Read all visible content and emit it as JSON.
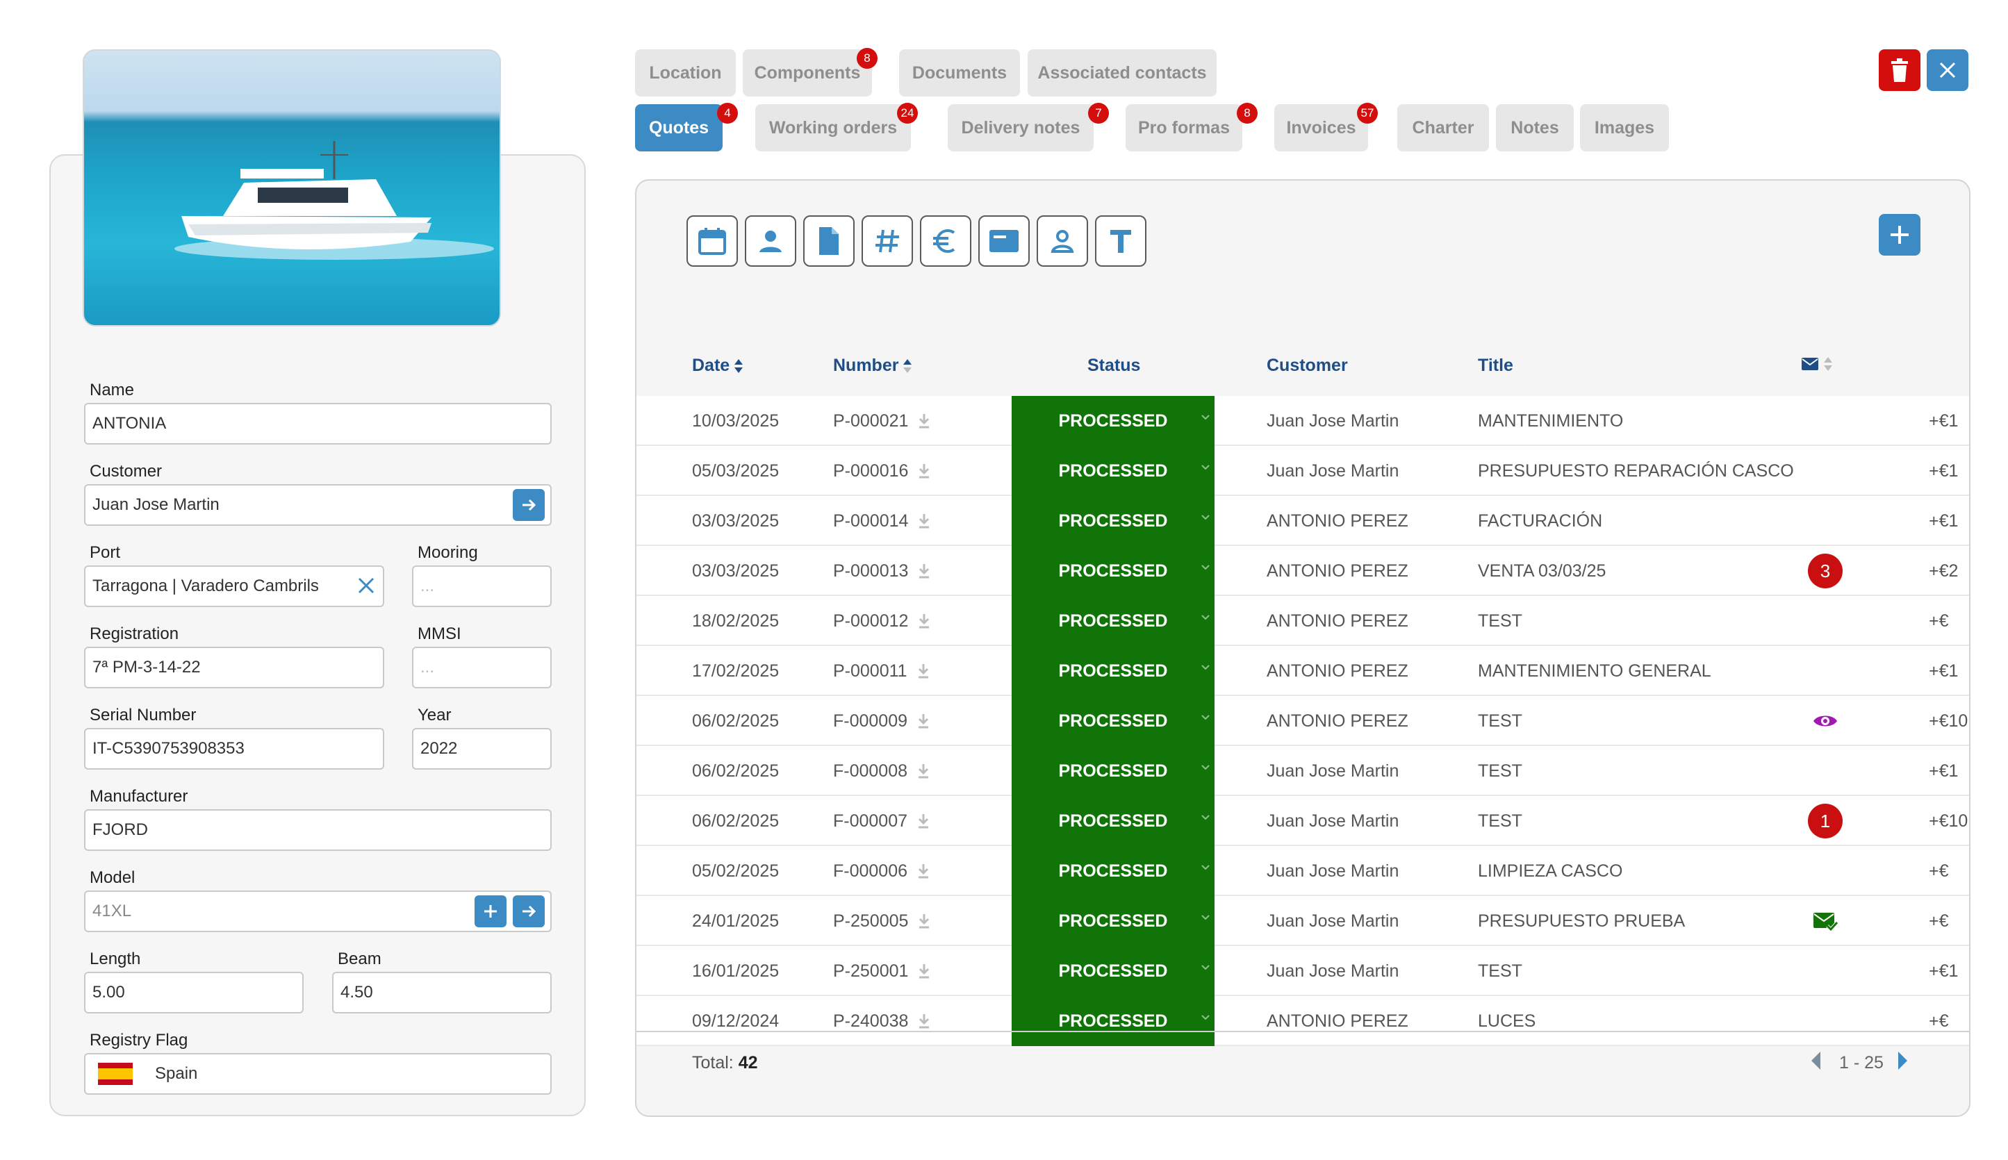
{
  "boat": {
    "fields": {
      "name": {
        "label": "Name",
        "value": "ANTONIA"
      },
      "customer": {
        "label": "Customer",
        "value": "Juan Jose Martin"
      },
      "port": {
        "label": "Port",
        "value": "Tarragona | Varadero Cambrils"
      },
      "mooring": {
        "label": "Mooring",
        "placeholder": "..."
      },
      "registration": {
        "label": "Registration",
        "value": "7ª PM-3-14-22"
      },
      "mmsi": {
        "label": "MMSI",
        "placeholder": "..."
      },
      "serial": {
        "label": "Serial Number",
        "value": "IT-C5390753908353"
      },
      "year": {
        "label": "Year",
        "value": "2022"
      },
      "manufacturer": {
        "label": "Manufacturer",
        "value": "FJORD"
      },
      "model": {
        "label": "Model",
        "value": "41XL"
      },
      "length": {
        "label": "Length",
        "value": "5.00"
      },
      "beam": {
        "label": "Beam",
        "value": "4.50"
      },
      "flag": {
        "label": "Registry Flag",
        "value": "Spain"
      }
    }
  },
  "tabs_row1": [
    {
      "label": "Location",
      "badge": ""
    },
    {
      "label": "Components",
      "badge": "8"
    },
    {
      "label": "Documents",
      "badge": ""
    },
    {
      "label": "Associated contacts",
      "badge": ""
    }
  ],
  "tabs_row2": [
    {
      "label": "Quotes",
      "badge": "4",
      "active": true
    },
    {
      "label": "Working orders",
      "badge": "24"
    },
    {
      "label": "Delivery notes",
      "badge": "7"
    },
    {
      "label": "Pro formas",
      "badge": "8"
    },
    {
      "label": "Invoices",
      "badge": "57"
    },
    {
      "label": "Charter",
      "badge": ""
    },
    {
      "label": "Notes",
      "badge": ""
    },
    {
      "label": "Images",
      "badge": ""
    }
  ],
  "toolbar_icons": [
    "calendar-icon",
    "user-icon",
    "document-icon",
    "hash-icon",
    "euro-icon",
    "card-icon",
    "contact-icon",
    "text-icon"
  ],
  "table": {
    "headers": {
      "date": "Date",
      "number": "Number",
      "status": "Status",
      "customer": "Customer",
      "title": "Title"
    },
    "rows": [
      {
        "date": "10/03/2025",
        "number": "P-000021",
        "status": "PROCESSED",
        "customer": "Juan Jose Martin",
        "title": "MANTENIMIENTO",
        "extra": "",
        "amount": "+€1"
      },
      {
        "date": "05/03/2025",
        "number": "P-000016",
        "status": "PROCESSED",
        "customer": "Juan Jose Martin",
        "title": "PRESUPUESTO REPARACIÓN CASCO",
        "extra": "",
        "amount": "+€1"
      },
      {
        "date": "03/03/2025",
        "number": "P-000014",
        "status": "PROCESSED",
        "customer": "ANTONIO PEREZ",
        "title": "FACTURACIÓN",
        "extra": "",
        "amount": "+€1"
      },
      {
        "date": "03/03/2025",
        "number": "P-000013",
        "status": "PROCESSED",
        "customer": "ANTONIO PEREZ",
        "title": "VENTA 03/03/25",
        "extra": "badge:3",
        "amount": "+€2"
      },
      {
        "date": "18/02/2025",
        "number": "P-000012",
        "status": "PROCESSED",
        "customer": "ANTONIO PEREZ",
        "title": "TEST",
        "extra": "",
        "amount": "+€"
      },
      {
        "date": "17/02/2025",
        "number": "P-000011",
        "status": "PROCESSED",
        "customer": "ANTONIO PEREZ",
        "title": "MANTENIMIENTO GENERAL",
        "extra": "",
        "amount": "+€1"
      },
      {
        "date": "06/02/2025",
        "number": "F-000009",
        "status": "PROCESSED",
        "customer": "ANTONIO PEREZ",
        "title": "TEST",
        "extra": "eye",
        "amount": "+€10"
      },
      {
        "date": "06/02/2025",
        "number": "F-000008",
        "status": "PROCESSED",
        "customer": "Juan Jose Martin",
        "title": "TEST",
        "extra": "",
        "amount": "+€1"
      },
      {
        "date": "06/02/2025",
        "number": "F-000007",
        "status": "PROCESSED",
        "customer": "Juan Jose Martin",
        "title": "TEST",
        "extra": "badge:1",
        "amount": "+€10"
      },
      {
        "date": "05/02/2025",
        "number": "F-000006",
        "status": "PROCESSED",
        "customer": "Juan Jose Martin",
        "title": "LIMPIEZA CASCO",
        "extra": "",
        "amount": "+€"
      },
      {
        "date": "24/01/2025",
        "number": "P-250005",
        "status": "PROCESSED",
        "customer": "Juan Jose Martin",
        "title": "PRESUPUESTO PRUEBA",
        "extra": "mailcheck",
        "amount": "+€"
      },
      {
        "date": "16/01/2025",
        "number": "P-250001",
        "status": "PROCESSED",
        "customer": "Juan Jose Martin",
        "title": "TEST",
        "extra": "",
        "amount": "+€1"
      },
      {
        "date": "09/12/2024",
        "number": "P-240038",
        "status": "PROCESSED",
        "customer": "ANTONIO PEREZ",
        "title": "LUCES",
        "extra": "",
        "amount": "+€"
      }
    ]
  },
  "footer": {
    "total_label": "Total:",
    "total_value": "42",
    "pagination": "1 - 25"
  },
  "colors": {
    "accent": "#3d8bc4",
    "status_green": "#107409",
    "badge_red": "#d40d0d",
    "delete_red": "#d40d0d",
    "header_blue": "#1f4e86"
  }
}
